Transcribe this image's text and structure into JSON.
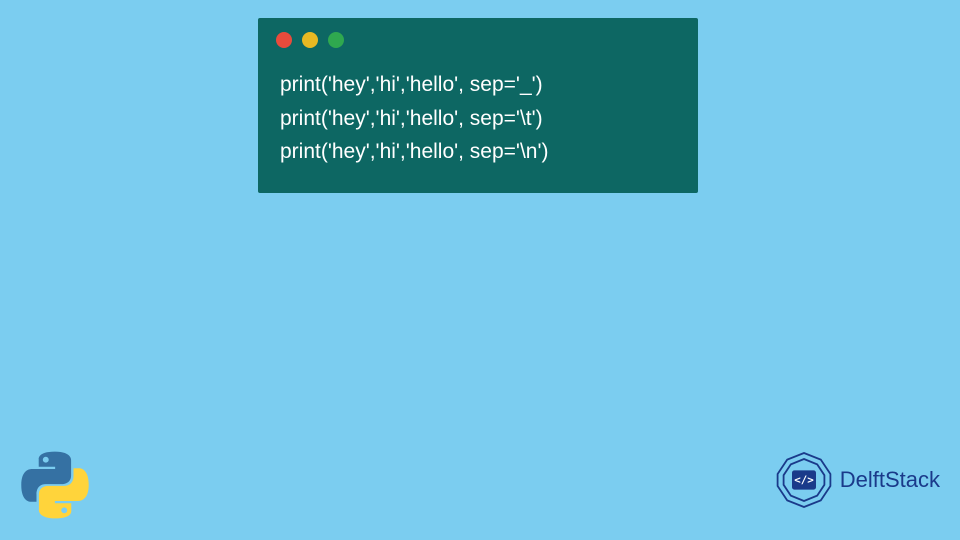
{
  "window": {
    "dots": [
      "red",
      "yellow",
      "green"
    ]
  },
  "code": {
    "lines": [
      "print('hey','hi','hello', sep='_')",
      "print('hey','hi','hello', sep='\\t')",
      "print('hey','hi','hello', sep='\\n')"
    ]
  },
  "brand": {
    "name": "DelftStack"
  }
}
